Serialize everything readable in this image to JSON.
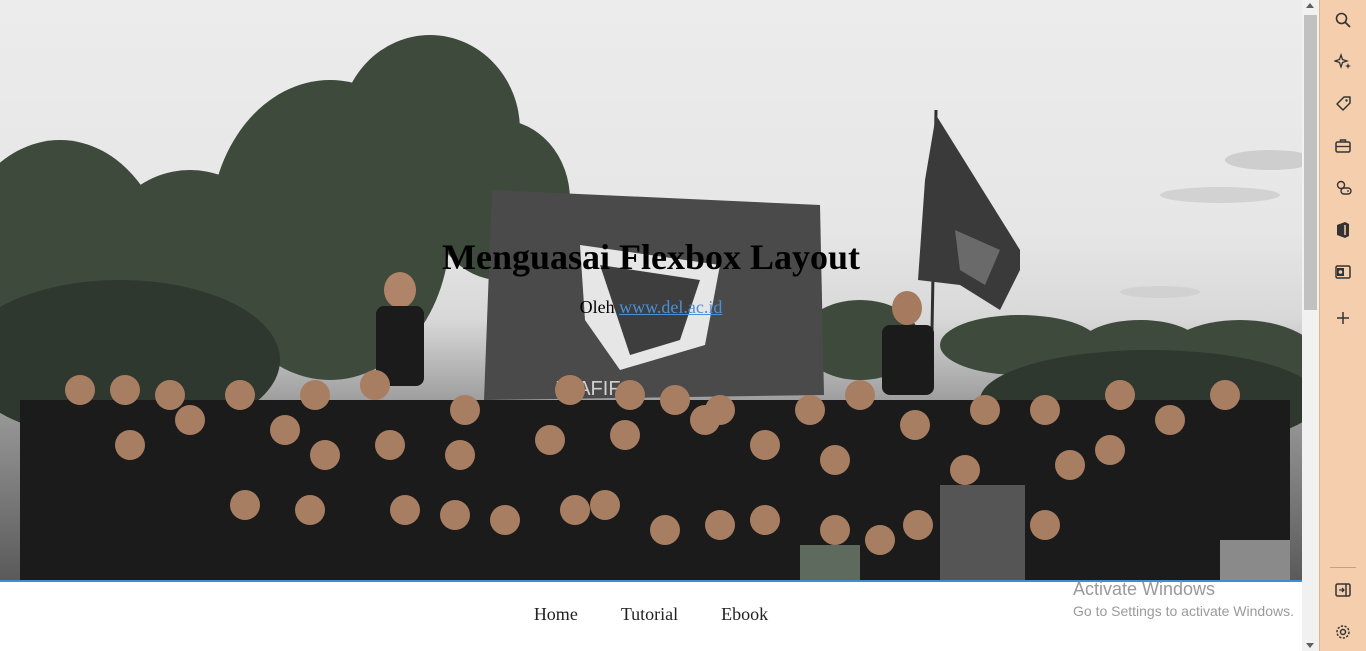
{
  "hero": {
    "title": "Menguasai Flexbox Layout",
    "byline_prefix": "Oleh ",
    "byline_link": "www.del.ac.id",
    "banner_text": "IMAFIF"
  },
  "nav": {
    "items": [
      "Home",
      "Tutorial",
      "Ebook"
    ]
  },
  "watermark": {
    "line1": "Activate Windows",
    "line2": "Go to Settings to activate Windows."
  },
  "sidebar": {
    "icons": [
      "search-icon",
      "copilot-sparkle-icon",
      "shopping-tag-icon",
      "tools-briefcase-icon",
      "games-icon",
      "office-icon",
      "outlook-icon",
      "add-icon",
      "sidebar-toggle-icon",
      "settings-gear-icon"
    ]
  }
}
